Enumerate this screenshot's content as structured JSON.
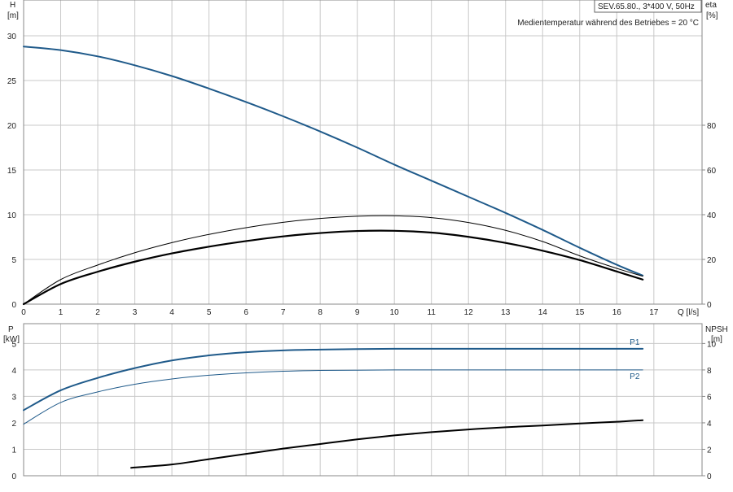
{
  "header": {
    "pump_label": "SEV.65.80., 3*400 V, 50Hz",
    "temperature_note": "Medientemperatur während des Betriebes = 20 °C"
  },
  "axes": {
    "h_name": "H",
    "h_unit": "[m]",
    "eta_name": "eta",
    "eta_unit": "[%]",
    "q_label": "Q [l/s]",
    "p_name": "P",
    "p_unit": "[kW]",
    "npsh_name": "NPSH",
    "npsh_unit": "[m]"
  },
  "colors": {
    "head_curve": "#1f5a8a",
    "power_curve": "#1f5a8a",
    "efficiency_curve": "#000000",
    "npsh_curve": "#000000",
    "grid": "#c8c8c8"
  },
  "chart_data": [
    {
      "type": "line",
      "panel": "top",
      "x_ticks": [
        0,
        1,
        2,
        3,
        4,
        5,
        6,
        7,
        8,
        9,
        10,
        11,
        12,
        13,
        14,
        15,
        16,
        17
      ],
      "xlim": [
        0,
        18.3
      ],
      "left_ticks": [
        0,
        5,
        10,
        15,
        20,
        25,
        30
      ],
      "ylim_left": [
        0,
        34
      ],
      "right_ticks": [
        0,
        20,
        40,
        60,
        80
      ],
      "ylim_right": [
        0,
        136
      ],
      "grid": true,
      "series": [
        {
          "key": "head",
          "axis": "left",
          "x": [
            0,
            1,
            2,
            3,
            4,
            5,
            6,
            7,
            8,
            9,
            10,
            11,
            12,
            13,
            14,
            15,
            16,
            16.7
          ],
          "y": [
            28.8,
            28.4,
            27.7,
            26.7,
            25.5,
            24.1,
            22.6,
            21.0,
            19.3,
            17.5,
            15.6,
            13.8,
            12.0,
            10.2,
            8.3,
            6.3,
            4.4,
            3.2
          ]
        },
        {
          "key": "efficiency_thin",
          "axis": "right",
          "x": [
            0,
            1,
            2,
            3,
            4,
            5,
            6,
            7,
            8,
            9,
            10,
            11,
            12,
            13,
            14,
            15,
            16,
            16.7
          ],
          "y": [
            0,
            11,
            17.5,
            23,
            27.5,
            31.2,
            34.2,
            36.6,
            38.3,
            39.3,
            39.5,
            38.7,
            36.5,
            33.0,
            28.0,
            21.6,
            16.0,
            12.5
          ]
        },
        {
          "key": "efficiency_bold",
          "axis": "right",
          "x": [
            0,
            1,
            2,
            3,
            4,
            5,
            6,
            7,
            8,
            9,
            10,
            11,
            12,
            13,
            14,
            15,
            16,
            16.7
          ],
          "y": [
            0,
            9,
            14.5,
            19,
            22.7,
            25.7,
            28.2,
            30.3,
            31.8,
            32.7,
            32.8,
            32.0,
            30.1,
            27.4,
            23.9,
            19.7,
            14.6,
            11.0
          ]
        }
      ]
    },
    {
      "type": "line",
      "panel": "bottom",
      "x_ticks": [
        0,
        1,
        2,
        3,
        4,
        5,
        6,
        7,
        8,
        9,
        10,
        11,
        12,
        13,
        14,
        15,
        16,
        17
      ],
      "xlim": [
        0,
        18.3
      ],
      "left_ticks": [
        0,
        1,
        2,
        3,
        4,
        5
      ],
      "ylim_left": [
        0,
        5.75
      ],
      "right_ticks": [
        0,
        2,
        4,
        6,
        8,
        10
      ],
      "ylim_right": [
        0,
        11.5
      ],
      "grid": true,
      "series": [
        {
          "name": "P1",
          "axis": "left",
          "x": [
            0,
            1,
            2,
            3,
            4,
            5,
            6,
            7,
            8,
            9,
            10,
            11,
            12,
            13,
            14,
            15,
            16,
            16.7
          ],
          "y": [
            2.48,
            3.23,
            3.7,
            4.07,
            4.36,
            4.55,
            4.67,
            4.74,
            4.77,
            4.79,
            4.8,
            4.8,
            4.8,
            4.8,
            4.8,
            4.8,
            4.8,
            4.8
          ]
        },
        {
          "name": "P2",
          "axis": "left",
          "x": [
            0,
            1,
            2,
            3,
            4,
            5,
            6,
            7,
            8,
            9,
            10,
            11,
            12,
            13,
            14,
            15,
            16,
            16.7
          ],
          "y": [
            1.95,
            2.77,
            3.17,
            3.46,
            3.66,
            3.8,
            3.89,
            3.95,
            3.98,
            3.99,
            4.0,
            4.0,
            4.0,
            4.0,
            4.0,
            4.0,
            4.0,
            4.0
          ]
        },
        {
          "key": "npsh",
          "axis": "right",
          "x": [
            2.9,
            4,
            5,
            6,
            7,
            8,
            9,
            10,
            11,
            12,
            13,
            14,
            15,
            16,
            16.7
          ],
          "y": [
            0.6,
            0.85,
            1.25,
            1.65,
            2.05,
            2.4,
            2.75,
            3.05,
            3.3,
            3.5,
            3.67,
            3.8,
            3.95,
            4.08,
            4.2
          ]
        }
      ]
    }
  ]
}
